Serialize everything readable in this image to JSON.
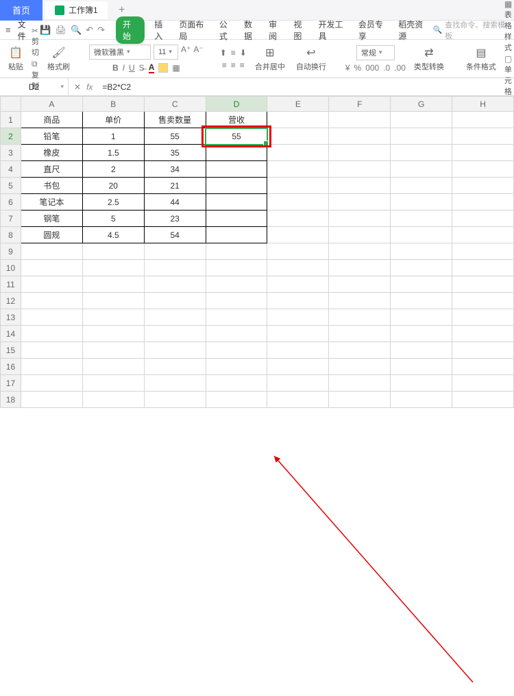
{
  "titlebar": {
    "home_tab": "首页",
    "doc_tab": "工作簿1",
    "add_tab": "+"
  },
  "menubar": {
    "file": "文件",
    "tabs": [
      "开始",
      "插入",
      "页面布局",
      "公式",
      "数据",
      "审阅",
      "视图",
      "开发工具",
      "会员专享",
      "稻壳资源"
    ],
    "search_placeholder": "查找命令、搜索模板"
  },
  "ribbon": {
    "paste": "粘贴",
    "cut": "剪切",
    "copy": "复制",
    "fmtpaint": "格式刷",
    "font_name": "微软雅黑",
    "font_size": "11",
    "merge_center": "合并居中",
    "autowrap": "自动换行",
    "general": "常规",
    "type_convert": "类型转换",
    "cond_fmt": "条件格式",
    "table_style": "表格样式",
    "cell_style": "单元格样式"
  },
  "formula_bar": {
    "name_box": "D2",
    "formula": "=B2*C2"
  },
  "columns": [
    "A",
    "B",
    "C",
    "D",
    "E",
    "F",
    "G",
    "H"
  ],
  "headers": {
    "A": "商品",
    "B": "单价",
    "C": "售卖数量",
    "D": "营收"
  },
  "rows": [
    {
      "A": "铅笔",
      "B": "1",
      "C": "55",
      "D": "55"
    },
    {
      "A": "橡皮",
      "B": "1.5",
      "C": "35",
      "D": ""
    },
    {
      "A": "直尺",
      "B": "2",
      "C": "34",
      "D": ""
    },
    {
      "A": "书包",
      "B": "20",
      "C": "21",
      "D": ""
    },
    {
      "A": "笔记本",
      "B": "2.5",
      "C": "44",
      "D": ""
    },
    {
      "A": "钢笔",
      "B": "5",
      "C": "23",
      "D": ""
    },
    {
      "A": "圆规",
      "B": "4.5",
      "C": "54",
      "D": ""
    }
  ],
  "selected_cell": "D2",
  "chart_data": {
    "type": "table",
    "title": "营收",
    "columns": [
      "商品",
      "单价",
      "售卖数量",
      "营收"
    ],
    "data": [
      [
        "铅笔",
        1,
        55,
        55
      ],
      [
        "橡皮",
        1.5,
        35,
        null
      ],
      [
        "直尺",
        2,
        34,
        null
      ],
      [
        "书包",
        20,
        21,
        null
      ],
      [
        "笔记本",
        2.5,
        44,
        null
      ],
      [
        "钢笔",
        5,
        23,
        null
      ],
      [
        "圆规",
        4.5,
        54,
        null
      ]
    ]
  }
}
